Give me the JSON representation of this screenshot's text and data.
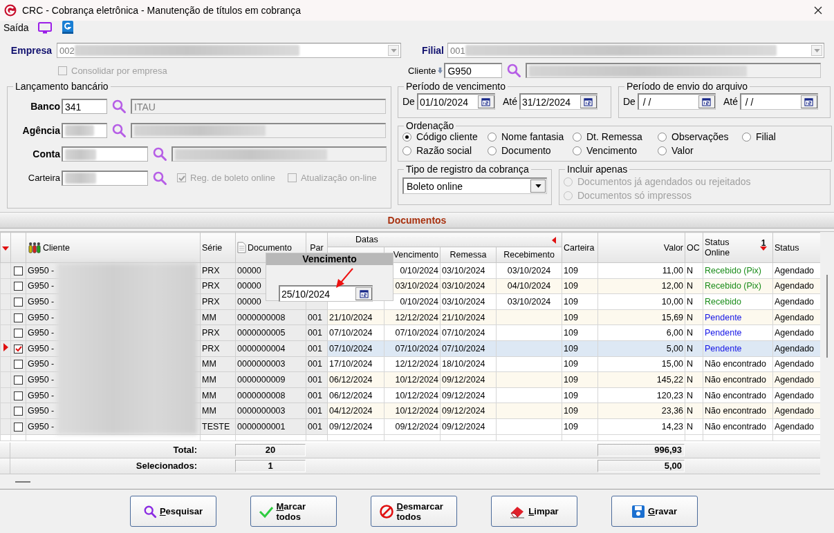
{
  "window": {
    "title": "CRC - Cobrança eletrônica - Manutenção de títulos em cobrança"
  },
  "menu": {
    "label": "Saída"
  },
  "empresa": {
    "label": "Empresa",
    "value": "002"
  },
  "filial": {
    "label": "Filial",
    "value": "001"
  },
  "consolidar": {
    "label": "Consolidar por empresa",
    "checked": false,
    "disabled": true
  },
  "cliente": {
    "label": "Cliente",
    "value": "G950"
  },
  "lancamento": {
    "title": "Lançamento bancário",
    "banco": {
      "label": "Banco",
      "value": "341",
      "name": "ITAU"
    },
    "agencia": {
      "label": "Agência"
    },
    "conta": {
      "label": "Conta"
    },
    "carteira": {
      "label": "Carteira"
    },
    "options": [
      {
        "label": "Reg. de boleto online",
        "checked": true,
        "disabled": true
      },
      {
        "label": "Atualização on-line",
        "checked": false,
        "disabled": true
      }
    ]
  },
  "periodos": [
    {
      "title": "Período de vencimento",
      "from_label": "De",
      "from": "01/10/2024",
      "to_label": "Até",
      "to": "31/12/2024"
    },
    {
      "title": "Período de envio do arquivo",
      "from_label": "De",
      "from": " / /",
      "to_label": "Até",
      "to": " / /"
    }
  ],
  "ordenacao": {
    "title": "Ordenação",
    "options": [
      {
        "label": "Código cliente",
        "selected": true
      },
      {
        "label": "Nome fantasia",
        "selected": false
      },
      {
        "label": "Dt. Remessa",
        "selected": false
      },
      {
        "label": "Observações",
        "selected": false
      },
      {
        "label": "Filial",
        "selected": false
      },
      {
        "label": "Razão social",
        "selected": false
      },
      {
        "label": "Documento",
        "selected": false
      },
      {
        "label": "Vencimento",
        "selected": false
      },
      {
        "label": "Valor",
        "selected": false
      }
    ]
  },
  "tipo_registro": {
    "title": "Tipo de registro da cobrança",
    "value": "Boleto online"
  },
  "incluir": {
    "title": "Incluir apenas",
    "options": [
      {
        "label": "Documentos já agendados ou rejeitados",
        "selected": false,
        "disabled": true
      },
      {
        "label": "Documentos só impressos",
        "selected": false,
        "disabled": true
      }
    ]
  },
  "section_title": "Documentos",
  "table": {
    "columns": {
      "cliente": "Cliente",
      "serie": "Série",
      "documento": "Documento",
      "par": "Par",
      "datas": "Datas",
      "vencimento": "Vencimento",
      "remessa": "Remessa",
      "recebimento": "Recebimento",
      "carteira": "Carteira",
      "valor": "Valor",
      "oc": "OC",
      "status_online": "Status Online",
      "sort_rank": "1",
      "status": "Status"
    },
    "rows": [
      {
        "client": "G950 -",
        "serie": "PRX",
        "document": "00000",
        "vencimento": "0/10/2024",
        "remessa": "03/10/2024",
        "recebimento": "03/10/2024",
        "carteira": "109",
        "valor": "11,00",
        "oc": "N",
        "status_online": "Recebido (Pix)",
        "color": "#1a8c1a",
        "status": "Agendado",
        "checked": false,
        "selected": false
      },
      {
        "client": "G950 -",
        "serie": "PRX",
        "document": "00000",
        "vencimento": "03/10/2024",
        "remessa": "03/10/2024",
        "recebimento": "04/10/2024",
        "carteira": "109",
        "valor": "12,00",
        "oc": "N",
        "status_online": "Recebido (Pix)",
        "color": "#1a8c1a",
        "status": "Agendado",
        "checked": false,
        "selected": false
      },
      {
        "client": "G950 -",
        "serie": "PRX",
        "document": "00000",
        "vencimento": "0/10/2024",
        "remessa": "03/10/2024",
        "recebimento": "03/10/2024",
        "carteira": "109",
        "valor": "10,00",
        "oc": "N",
        "status_online": "Recebido",
        "color": "#1a8c1a",
        "status": "Agendado",
        "checked": false,
        "selected": false
      },
      {
        "client": "G950 -",
        "serie": "MM",
        "document": "0000000008",
        "par": "001",
        "emissao": "21/10/2024",
        "vencimento": "12/12/2024",
        "remessa": "21/10/2024",
        "carteira": "109",
        "valor": "15,69",
        "oc": "N",
        "status_online": "Pendente",
        "color": "#1414e6",
        "status": "Agendado",
        "checked": false,
        "selected": false
      },
      {
        "client": "G950 -",
        "serie": "PRX",
        "document": "0000000005",
        "par": "001",
        "emissao": "07/10/2024",
        "vencimento": "07/10/2024",
        "remessa": "07/10/2024",
        "carteira": "109",
        "valor": "6,00",
        "oc": "N",
        "status_online": "Pendente",
        "color": "#1414e6",
        "status": "Agendado",
        "checked": false,
        "selected": false
      },
      {
        "client": "G950 -",
        "serie": "PRX",
        "document": "0000000004",
        "par": "001",
        "emissao": "07/10/2024",
        "vencimento": "07/10/2024",
        "remessa": "07/10/2024",
        "carteira": "109",
        "valor": "5,00",
        "oc": "N",
        "status_online": "Pendente",
        "color": "#1414e6",
        "status": "Agendado",
        "checked": true,
        "selected": true
      },
      {
        "client": "G950 -",
        "serie": "MM",
        "document": "0000000003",
        "par": "001",
        "emissao": "17/10/2024",
        "vencimento": "12/12/2024",
        "remessa": "18/10/2024",
        "carteira": "109",
        "valor": "15,00",
        "oc": "N",
        "status_online": "Não encontrado",
        "color": "#000000",
        "status": "Agendado",
        "checked": false,
        "selected": false
      },
      {
        "client": "G950 -",
        "serie": "MM",
        "document": "0000000009",
        "par": "001",
        "emissao": "06/12/2024",
        "vencimento": "10/12/2024",
        "remessa": "09/12/2024",
        "carteira": "109",
        "valor": "145,22",
        "oc": "N",
        "status_online": "Não encontrado",
        "color": "#000000",
        "status": "Agendado",
        "checked": false,
        "selected": false
      },
      {
        "client": "G950 -",
        "serie": "MM",
        "document": "0000000008",
        "par": "001",
        "emissao": "06/12/2024",
        "vencimento": "10/12/2024",
        "remessa": "09/12/2024",
        "carteira": "109",
        "valor": "120,23",
        "oc": "N",
        "status_online": "Não encontrado",
        "color": "#000000",
        "status": "Agendado",
        "checked": false,
        "selected": false
      },
      {
        "client": "G950 -",
        "serie": "MM",
        "document": "0000000003",
        "par": "001",
        "emissao": "04/12/2024",
        "vencimento": "10/12/2024",
        "remessa": "09/12/2024",
        "carteira": "109",
        "valor": "23,36",
        "oc": "N",
        "status_online": "Não encontrado",
        "color": "#000000",
        "status": "Agendado",
        "checked": false,
        "selected": false
      },
      {
        "client": "G950 -",
        "serie": "TESTE",
        "document": "0000000001",
        "par": "001",
        "emissao": "09/12/2024",
        "vencimento": "09/12/2024",
        "remessa": "09/12/2024",
        "carteira": "109",
        "valor": "14,23",
        "oc": "N",
        "status_online": "Não encontrado",
        "color": "#000000",
        "status": "Agendado",
        "checked": false,
        "selected": false
      }
    ],
    "totals": [
      {
        "label": "Total:",
        "count": "20",
        "value": "996,93"
      },
      {
        "label": "Selecionados:",
        "count": "1",
        "value": "5,00"
      }
    ]
  },
  "popup": {
    "title": "Vencimento",
    "value": "25/10/2024"
  },
  "buttons": [
    {
      "label": "Pesquisar",
      "kind": "search"
    },
    {
      "label": "Marcar todos",
      "kind": "check"
    },
    {
      "label": "Desmarcar todos",
      "kind": "uncheck"
    },
    {
      "label": "Limpar",
      "kind": "clear"
    },
    {
      "label": "Gravar",
      "kind": "save"
    }
  ]
}
